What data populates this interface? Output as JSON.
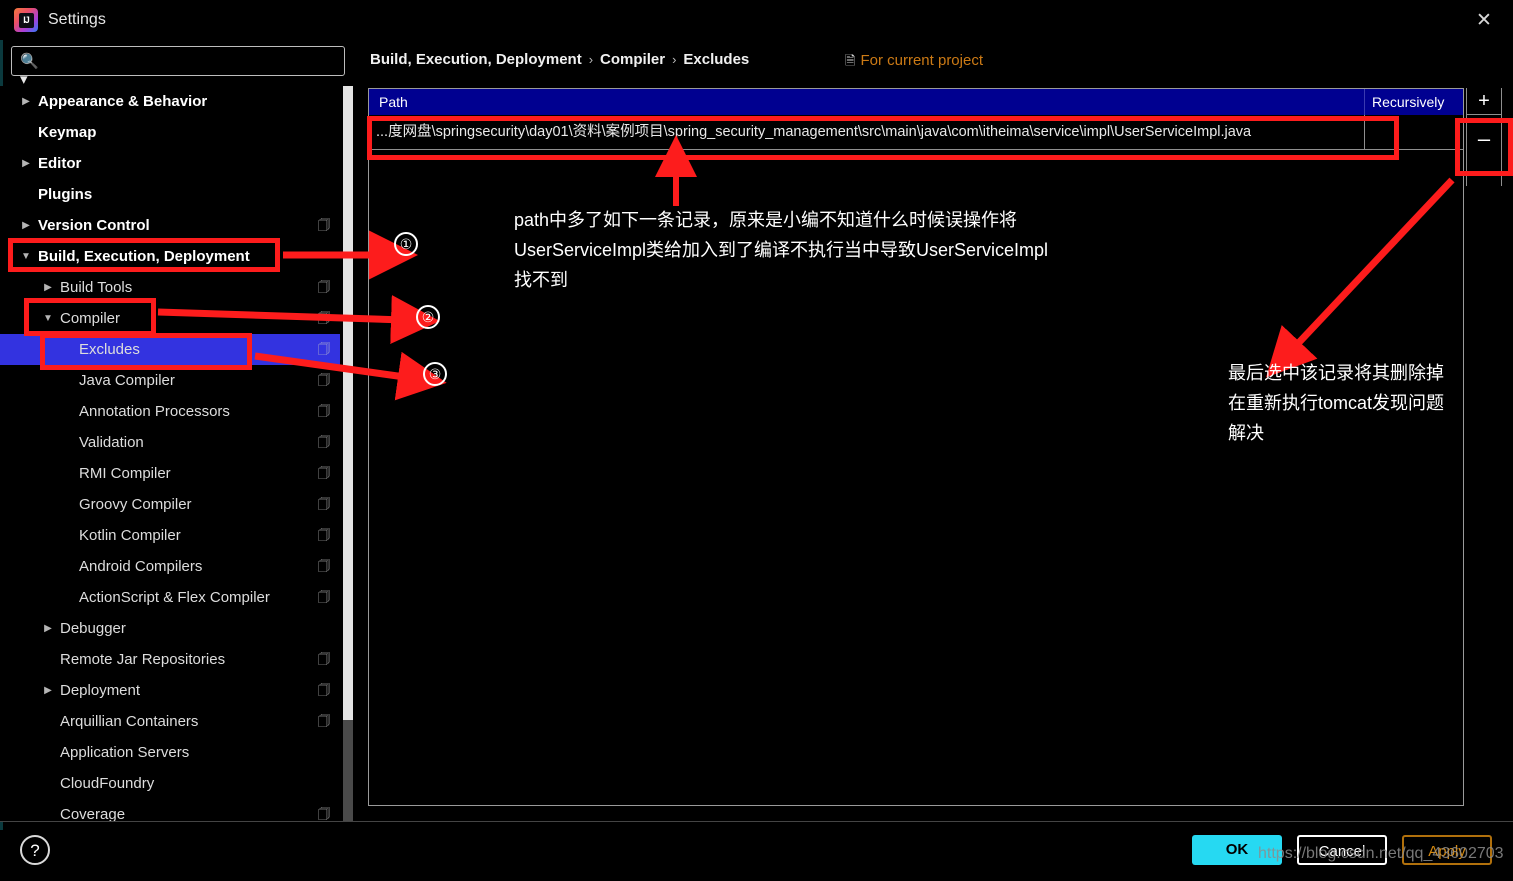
{
  "window": {
    "title": "Settings",
    "app_icon": "intellij-idea-icon",
    "close_icon": "close-icon"
  },
  "search": {
    "value": "",
    "placeholder": "",
    "icon": "search-icon"
  },
  "sidebar": {
    "items": [
      {
        "label": "Appearance & Behavior",
        "depth": 0,
        "arrow": "▶",
        "bold": true,
        "selected": false,
        "copy": false
      },
      {
        "label": "Keymap",
        "depth": 0,
        "arrow": "",
        "bold": true,
        "selected": false,
        "copy": false
      },
      {
        "label": "Editor",
        "depth": 0,
        "arrow": "▶",
        "bold": true,
        "selected": false,
        "copy": false
      },
      {
        "label": "Plugins",
        "depth": 0,
        "arrow": "",
        "bold": true,
        "selected": false,
        "copy": false
      },
      {
        "label": "Version Control",
        "depth": 0,
        "arrow": "▶",
        "bold": true,
        "selected": false,
        "copy": true
      },
      {
        "label": "Build, Execution, Deployment",
        "depth": 0,
        "arrow": "▼",
        "bold": true,
        "selected": false,
        "copy": false
      },
      {
        "label": "Build Tools",
        "depth": 1,
        "arrow": "▶",
        "bold": false,
        "selected": false,
        "copy": true
      },
      {
        "label": "Compiler",
        "depth": 1,
        "arrow": "▼",
        "bold": false,
        "selected": false,
        "copy": true
      },
      {
        "label": "Excludes",
        "depth": 2,
        "arrow": "",
        "bold": false,
        "selected": true,
        "copy": true
      },
      {
        "label": "Java Compiler",
        "depth": 2,
        "arrow": "",
        "bold": false,
        "selected": false,
        "copy": true
      },
      {
        "label": "Annotation Processors",
        "depth": 2,
        "arrow": "",
        "bold": false,
        "selected": false,
        "copy": true
      },
      {
        "label": "Validation",
        "depth": 2,
        "arrow": "",
        "bold": false,
        "selected": false,
        "copy": true
      },
      {
        "label": "RMI Compiler",
        "depth": 2,
        "arrow": "",
        "bold": false,
        "selected": false,
        "copy": true
      },
      {
        "label": "Groovy Compiler",
        "depth": 2,
        "arrow": "",
        "bold": false,
        "selected": false,
        "copy": true
      },
      {
        "label": "Kotlin Compiler",
        "depth": 2,
        "arrow": "",
        "bold": false,
        "selected": false,
        "copy": true
      },
      {
        "label": "Android Compilers",
        "depth": 2,
        "arrow": "",
        "bold": false,
        "selected": false,
        "copy": true
      },
      {
        "label": "ActionScript & Flex Compiler",
        "depth": 2,
        "arrow": "",
        "bold": false,
        "selected": false,
        "copy": true
      },
      {
        "label": "Debugger",
        "depth": 1,
        "arrow": "▶",
        "bold": false,
        "selected": false,
        "copy": false
      },
      {
        "label": "Remote Jar Repositories",
        "depth": 1,
        "arrow": "",
        "bold": false,
        "selected": false,
        "copy": true
      },
      {
        "label": "Deployment",
        "depth": 1,
        "arrow": "▶",
        "bold": false,
        "selected": false,
        "copy": true
      },
      {
        "label": "Arquillian Containers",
        "depth": 1,
        "arrow": "",
        "bold": false,
        "selected": false,
        "copy": true
      },
      {
        "label": "Application Servers",
        "depth": 1,
        "arrow": "",
        "bold": false,
        "selected": false,
        "copy": false
      },
      {
        "label": "CloudFoundry",
        "depth": 1,
        "arrow": "",
        "bold": false,
        "selected": false,
        "copy": false
      },
      {
        "label": "Coverage",
        "depth": 1,
        "arrow": "",
        "bold": false,
        "selected": false,
        "copy": true
      }
    ]
  },
  "content": {
    "breadcrumb": [
      "Build, Execution, Deployment",
      "Compiler",
      "Excludes"
    ],
    "breadcrumb_separator": "›",
    "scope_label": "For current project",
    "scope_icon": "project-scope-icon",
    "table": {
      "columns": [
        "Path",
        "Recursively"
      ],
      "rows": [
        {
          "path": "...度网盘\\springsecurity\\day01\\资料\\案例项目\\spring_security_management\\src\\main\\java\\com\\itheima\\service\\impl\\UserServiceImpl.java",
          "recursively": ""
        }
      ]
    },
    "toolbar": {
      "add_label": "+",
      "remove_label": "–"
    }
  },
  "annotations": {
    "marker_1": "①",
    "marker_2": "②",
    "marker_3": "③",
    "note_left": "path中多了如下一条记录，原来是小编不知道什么时候误操作将\nUserServiceImpl类给加入到了编译不执行当中导致UserServiceImpl\n找不到",
    "note_right": "最后选中该记录将其删除掉\n在重新执行tomcat发现问题\n解决",
    "color": "#fd1c1c"
  },
  "footer": {
    "help_label": "?",
    "ok_label": "OK",
    "cancel_label": "Cancel",
    "apply_label": "Apply",
    "watermark": "https://blog.csdn.net/qq_43602703"
  }
}
